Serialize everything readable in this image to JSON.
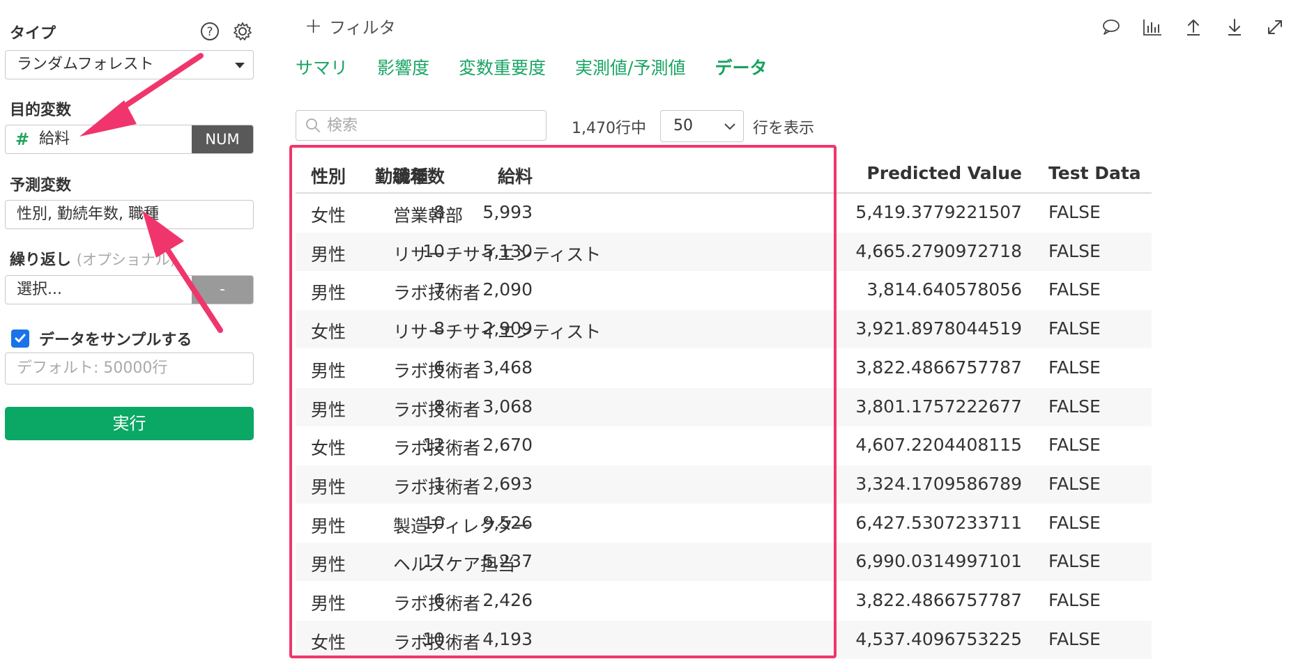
{
  "sidebar": {
    "type_label": "タイプ",
    "type_value": "ランダムフォレスト",
    "target_label": "目的変数",
    "target_hash": "#",
    "target_value": "給料",
    "target_type": "NUM",
    "predictors_label": "予測変数",
    "predictors_value": "性別, 勤続年数, 職種",
    "repeat_label": "繰り返し",
    "repeat_optional": "(オプショナル)",
    "repeat_value": "選択...",
    "repeat_dash": "-",
    "sample_label": "データをサンプルする",
    "sample_placeholder": "デフォルト: 50000行",
    "run_label": "実行"
  },
  "toolbar": {
    "filter_plus": "+",
    "filter_label": "フィルタ"
  },
  "tabs": [
    {
      "label": "サマリ"
    },
    {
      "label": "影響度"
    },
    {
      "label": "変数重要度"
    },
    {
      "label": "実測値/予測値"
    },
    {
      "label": "データ",
      "active": true
    }
  ],
  "search": {
    "placeholder": "検索",
    "row_count": "1,470行中",
    "page_size": "50",
    "rows_label": "行を表示"
  },
  "table": {
    "columns": [
      "性別",
      "職種",
      "勤続年数",
      "給料",
      "Predicted Value",
      "Test Data"
    ],
    "rows": [
      [
        "女性",
        "営業幹部",
        "8",
        "5,993",
        "5,419.3779221507",
        "FALSE"
      ],
      [
        "男性",
        "リサーチサイエンティスト",
        "10",
        "5,130",
        "4,665.2790972718",
        "FALSE"
      ],
      [
        "男性",
        "ラボ技術者",
        "7",
        "2,090",
        "3,814.640578056",
        "FALSE"
      ],
      [
        "女性",
        "リサーチサイエンティスト",
        "8",
        "2,909",
        "3,921.8978044519",
        "FALSE"
      ],
      [
        "男性",
        "ラボ技術者",
        "6",
        "3,468",
        "3,822.4866757787",
        "FALSE"
      ],
      [
        "男性",
        "ラボ技術者",
        "8",
        "3,068",
        "3,801.1757222677",
        "FALSE"
      ],
      [
        "女性",
        "ラボ技術者",
        "12",
        "2,670",
        "4,607.2204408115",
        "FALSE"
      ],
      [
        "男性",
        "ラボ技術者",
        "1",
        "2,693",
        "3,324.1709586789",
        "FALSE"
      ],
      [
        "男性",
        "製造ディレクター",
        "10",
        "9,526",
        "6,427.5307233711",
        "FALSE"
      ],
      [
        "男性",
        "ヘルスケア担当",
        "17",
        "5,237",
        "6,990.0314997101",
        "FALSE"
      ],
      [
        "男性",
        "ラボ技術者",
        "6",
        "2,426",
        "3,822.4866757787",
        "FALSE"
      ],
      [
        "女性",
        "ラボ技術者",
        "10",
        "4,193",
        "4,537.4096753225",
        "FALSE"
      ]
    ]
  },
  "colors": {
    "accent_green": "#13a35c",
    "highlight_pink": "#f0356c",
    "checkbox_blue": "#1a73e8"
  }
}
